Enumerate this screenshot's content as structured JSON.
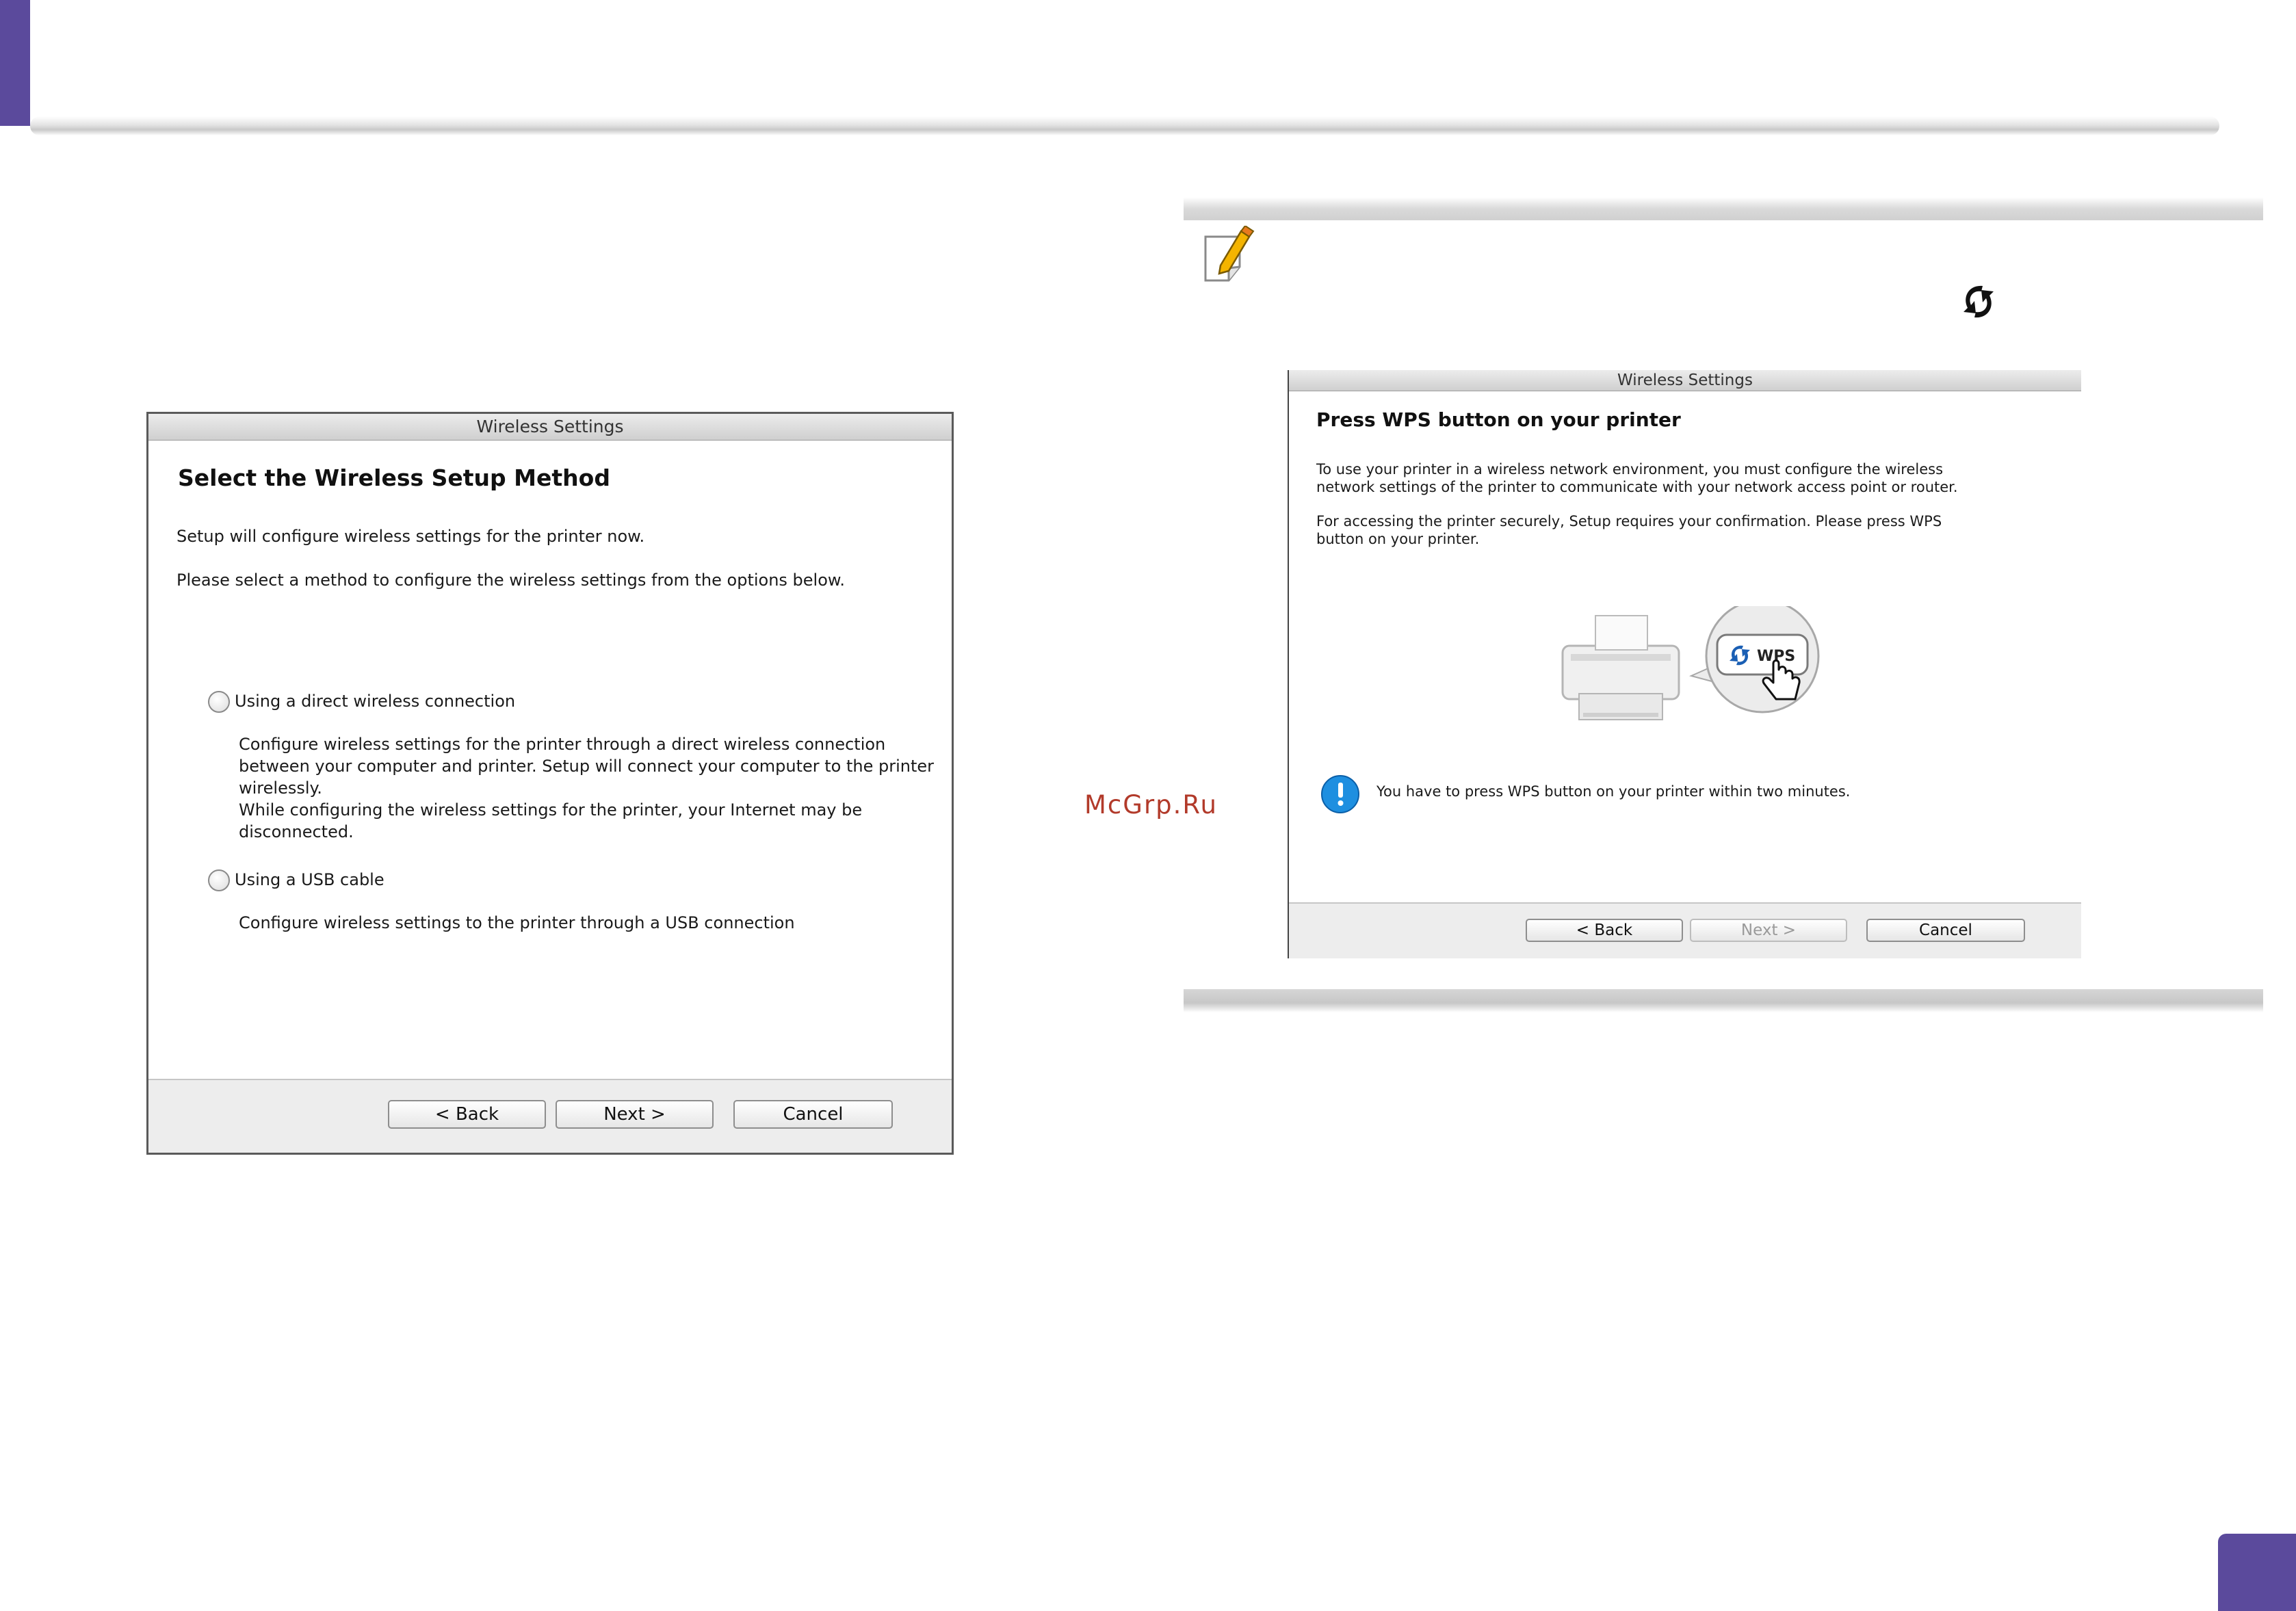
{
  "left_dialog": {
    "title": "Wireless Settings",
    "heading": "Select the Wireless Setup Method",
    "intro_1": "Setup will configure wireless settings for the printer now.",
    "intro_2": "Please select a method to configure the wireless settings from the options below.",
    "option_direct": {
      "label": "Using a direct wireless connection",
      "desc_lines": [
        "Configure wireless settings for the printer through a direct wireless connection",
        "between your computer and printer. Setup will connect your computer to the printer",
        "wirelessly.",
        "While configuring the wireless settings for the printer, your Internet may be",
        "disconnected."
      ]
    },
    "option_usb": {
      "label": "Using a USB cable",
      "desc": "Configure wireless settings to the printer through a USB connection"
    },
    "buttons": {
      "back": "< Back",
      "next": "Next >",
      "cancel": "Cancel"
    }
  },
  "right_dialog": {
    "title": "Wireless Settings",
    "heading": "Press WPS button on your printer",
    "para_1": [
      "To use your printer in a wireless network environment, you must configure the wireless",
      "network settings of the printer to communicate with your network access point or router."
    ],
    "para_2": [
      "For accessing the printer securely, Setup requires your confirmation. Please press WPS",
      "button on your printer."
    ],
    "wps_label": "WPS",
    "info_message": "You have to press WPS button on your printer within two minutes.",
    "buttons": {
      "back": "< Back",
      "next": "Next >",
      "cancel": "Cancel"
    }
  },
  "watermark": "McGrp.Ru",
  "icons": {
    "memo": "memo-note-icon",
    "wps": "wps-icon",
    "info": "info-icon",
    "printer": "printer-icon",
    "hand": "pointer-hand-icon"
  },
  "colors": {
    "accent": "#5b4a9c",
    "info_blue": "#1e8fe0",
    "wps_blue": "#1a5fb4",
    "watermark": "#b23a2a"
  }
}
